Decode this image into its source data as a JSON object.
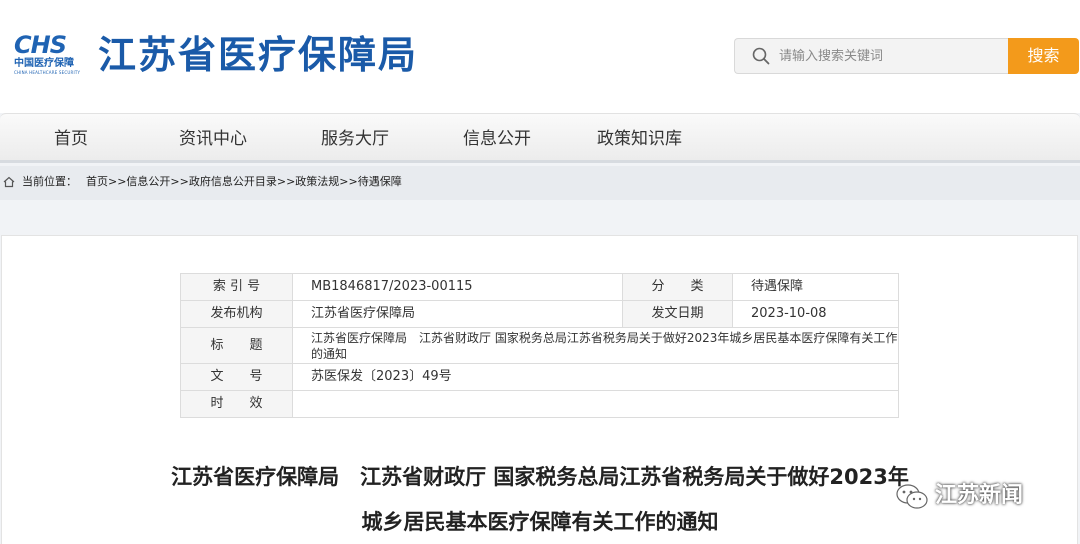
{
  "header": {
    "logo": {
      "mark": "CHS",
      "cn": "中国医疗保障",
      "en": "CHINA HEALTHCARE SECURITY"
    },
    "site_title": "江苏省医疗保障局",
    "search": {
      "placeholder": "请输入搜索关键词",
      "value": "",
      "icon": "search-icon",
      "button_label": "搜索"
    }
  },
  "nav": {
    "items": [
      {
        "label": "首页"
      },
      {
        "label": "资讯中心"
      },
      {
        "label": "服务大厅"
      },
      {
        "label": "信息公开"
      },
      {
        "label": "政策知识库"
      }
    ]
  },
  "breadcrumb": {
    "icon": "home-icon",
    "label": "当前位置：",
    "path": "首页>>信息公开>>政府信息公开目录>>政策法规>>待遇保障"
  },
  "meta": {
    "index_label": "索 引 号",
    "index_value": "MB1846817/2023-00115",
    "category_label": "分　　类",
    "category_value": "待遇保障",
    "issuer_label": "发布机构",
    "issuer_value": "江苏省医疗保障局",
    "date_label": "发文日期",
    "date_value": "2023-10-08",
    "title_label": "标　　题",
    "title_value": "江苏省医疗保障局　江苏省财政厅 国家税务总局江苏省税务局关于做好2023年城乡居民基本医疗保障有关工作的通知",
    "docno_label": "文　　号",
    "docno_value": "苏医保发〔2023〕49号",
    "validity_label": "时　　效",
    "validity_value": ""
  },
  "document": {
    "title_line1": "江苏省医疗保障局　江苏省财政厅 国家税务总局江苏省税务局关于做好2023年",
    "title_line2": "城乡居民基本医疗保障有关工作的通知"
  },
  "watermark": {
    "icon": "wechat-icon",
    "text": "江苏新闻"
  },
  "colors": {
    "brand_blue": "#1a5aa8",
    "search_button": "#f39a1b"
  }
}
